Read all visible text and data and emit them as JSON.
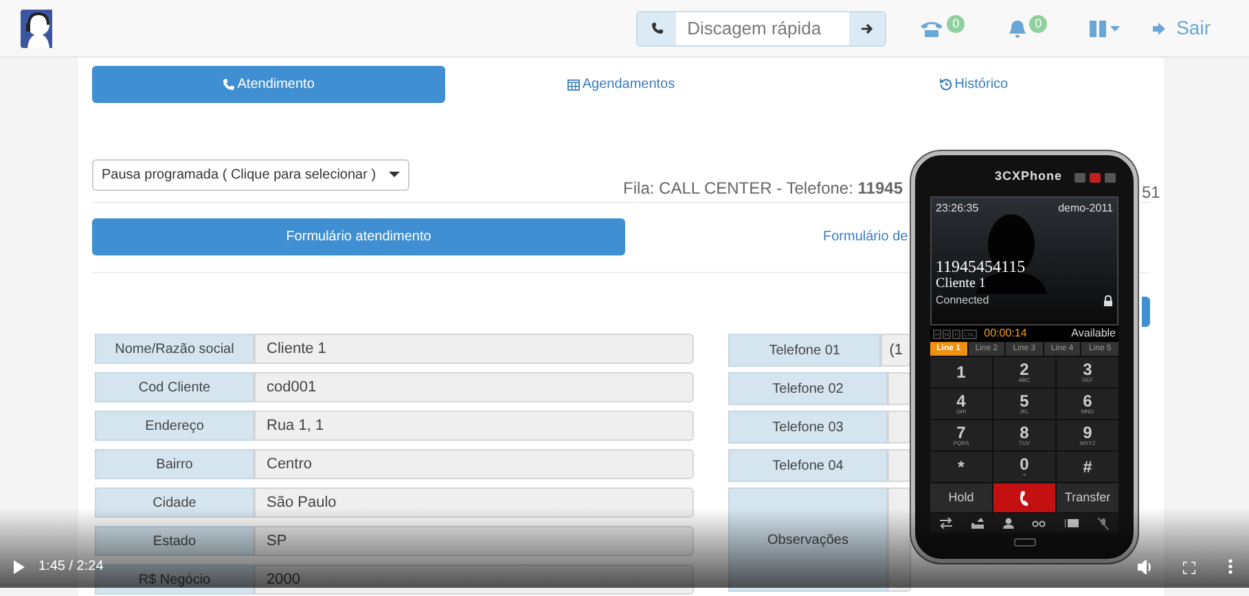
{
  "header": {
    "quick_dial": {
      "placeholder": "Discagem rápida"
    },
    "phone_badge": "0",
    "bell_badge": "0",
    "logout": "Sair"
  },
  "tabs": [
    {
      "label": "Atendimento",
      "selected": true
    },
    {
      "label": "Agendamentos",
      "selected": false
    },
    {
      "label": "Histórico",
      "selected": false
    }
  ],
  "pause_select": {
    "value": "Pausa programada ( Clique para selecionar )"
  },
  "queue_info": "Fila: CALL CENTER - Telefone: **11945**",
  "queue_info_tail": "51",
  "form_tabs": [
    {
      "label": "Formulário atendimento",
      "selected": true
    },
    {
      "label": "Formulário de",
      "selected": false
    }
  ],
  "fields_left": [
    {
      "label": "Nome/Razão social",
      "value": "Cliente 1"
    },
    {
      "label": "Cod Cliente",
      "value": "cod001"
    },
    {
      "label": "Endereço",
      "value": "Rua 1, 1"
    },
    {
      "label": "Bairro",
      "value": "Centro"
    },
    {
      "label": "Cidade",
      "value": "São Paulo"
    },
    {
      "label": "Estado",
      "value": "SP"
    },
    {
      "label": "R$ Negócio",
      "value": "2000"
    }
  ],
  "fields_right": [
    {
      "label": "Telefone 01",
      "value": "(1"
    },
    {
      "label": "Telefone 02"
    },
    {
      "label": "Telefone 03"
    },
    {
      "label": "Telefone 04"
    },
    {
      "label": "Observações",
      "kind": "textarea"
    }
  ],
  "softphone": {
    "title": "3CXPhone",
    "time": "23:26:35",
    "account": "demo-2011",
    "number": "11945454115",
    "name": "Cliente 1",
    "call_state": "Connected",
    "indicators": [
      "H",
      "M",
      "R",
      "CNL"
    ],
    "duration": "00:00:14",
    "presence": "Available",
    "lines": [
      {
        "label": "Line 1",
        "selected": true
      },
      {
        "label": "Line 2",
        "selected": false
      },
      {
        "label": "Line 3",
        "selected": false
      },
      {
        "label": "Line 4",
        "selected": false
      },
      {
        "label": "Line 5",
        "selected": false
      }
    ],
    "keys": [
      {
        "digit": "1"
      },
      {
        "digit": "2",
        "letters": "ABC"
      },
      {
        "digit": "3",
        "letters": "DEF"
      },
      {
        "digit": "4",
        "letters": "GHI"
      },
      {
        "digit": "5",
        "letters": "JKL"
      },
      {
        "digit": "6",
        "letters": "MNO"
      },
      {
        "digit": "7",
        "letters": "PQRS"
      },
      {
        "digit": "8",
        "letters": "TUV"
      },
      {
        "digit": "9",
        "letters": "WXYZ"
      },
      {
        "digit": "*"
      },
      {
        "digit": "0",
        "letters": "+"
      },
      {
        "digit": "#"
      }
    ],
    "hold": "Hold",
    "transfer": "Transfer"
  },
  "video": {
    "time": "1:45 / 2:24"
  }
}
